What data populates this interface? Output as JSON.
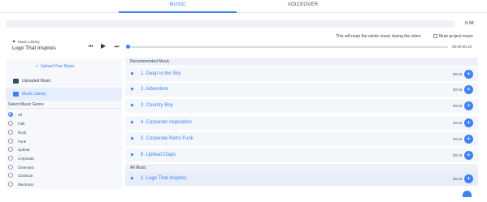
{
  "tabs": [
    {
      "label": "MUSIC",
      "active": true
    },
    {
      "label": "VOICEOVER",
      "active": false
    }
  ],
  "timeline": {
    "time": "0:08"
  },
  "mute": {
    "note": "This will mute the whole music during the video",
    "checkbox_label": "Mute project music",
    "checked": false
  },
  "player": {
    "library_label": "Music Library",
    "title": "Logo That Inspires",
    "time": "00:00-00:15",
    "progress": 0
  },
  "sidebar": {
    "upload_label": "Upload Your Music",
    "items": [
      {
        "label": "Uploaded Music",
        "active": false
      },
      {
        "label": "Music Library",
        "active": true
      }
    ],
    "genre_heading": "Select Music Genre",
    "genres": [
      "All",
      "Folk",
      "Rock",
      "Funk",
      "Upbeat",
      "Corporate",
      "Cinematic",
      "Classical",
      "Electronic"
    ],
    "selected_genre": "All"
  },
  "recommended": {
    "heading": "Recommended Music",
    "tracks": [
      {
        "name": "1. Deep to the Sky",
        "duration": "00:15"
      },
      {
        "name": "2. Adventure",
        "duration": "00:15"
      },
      {
        "name": "3. Country Boy",
        "duration": "00:15"
      },
      {
        "name": "4. Corporate Inspiration",
        "duration": "00:15"
      },
      {
        "name": "5. Corporate Retro Funk",
        "duration": "00:15"
      },
      {
        "name": "6. Upbeat Claps",
        "duration": "00:15"
      }
    ]
  },
  "all_music": {
    "heading": "All Music",
    "tracks": [
      {
        "name": "1. Logo That Inspires",
        "duration": "00:15",
        "active": true
      }
    ]
  },
  "icons": {
    "play": "play-icon",
    "prev": "skip-back-icon",
    "next": "skip-forward-icon",
    "add": "plus-icon",
    "folder": "folder-icon",
    "flag": "flag-icon"
  },
  "colors": {
    "accent": "#3d82f0",
    "text": "#3a4252",
    "panel": "#f6f8fb",
    "row": "#f3f6fa",
    "row_active": "#e6eefb"
  }
}
